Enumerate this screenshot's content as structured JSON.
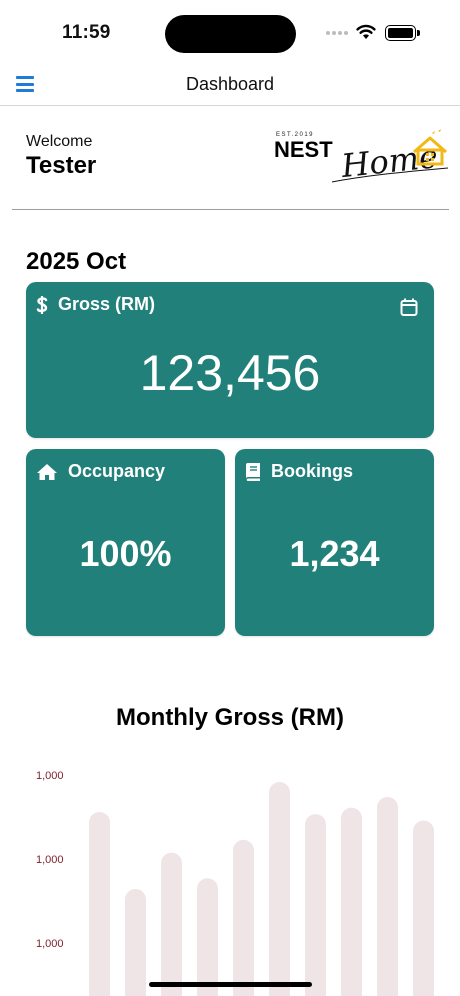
{
  "status_bar": {
    "time": "11:59"
  },
  "nav": {
    "title": "Dashboard"
  },
  "welcome": {
    "label": "Welcome",
    "name": "Tester"
  },
  "logo": {
    "est": "EST.2019",
    "brand": "NEST",
    "script": "Home"
  },
  "period": "2025 Oct",
  "cards": {
    "gross": {
      "label": "Gross (RM)",
      "value": "123,456",
      "icon": "dollar-icon",
      "action_icon": "calendar-icon"
    },
    "occupancy": {
      "label": "Occupancy",
      "value": "100%",
      "icon": "home-icon"
    },
    "bookings": {
      "label": "Bookings",
      "value": "1,234",
      "icon": "book-icon"
    }
  },
  "chart_data": {
    "type": "bar",
    "title": "Monthly Gross (RM)",
    "y_tick_labels": [
      "1,000",
      "1,000",
      "1,000"
    ],
    "values": [
      0.86,
      0.5,
      0.67,
      0.55,
      0.73,
      1.0,
      0.85,
      0.88,
      0.93,
      0.82
    ],
    "bar_color": "#efe4e6"
  },
  "colors": {
    "card": "#22807a",
    "menu": "#1e7bd8",
    "logo_gold": "#f2b816"
  }
}
